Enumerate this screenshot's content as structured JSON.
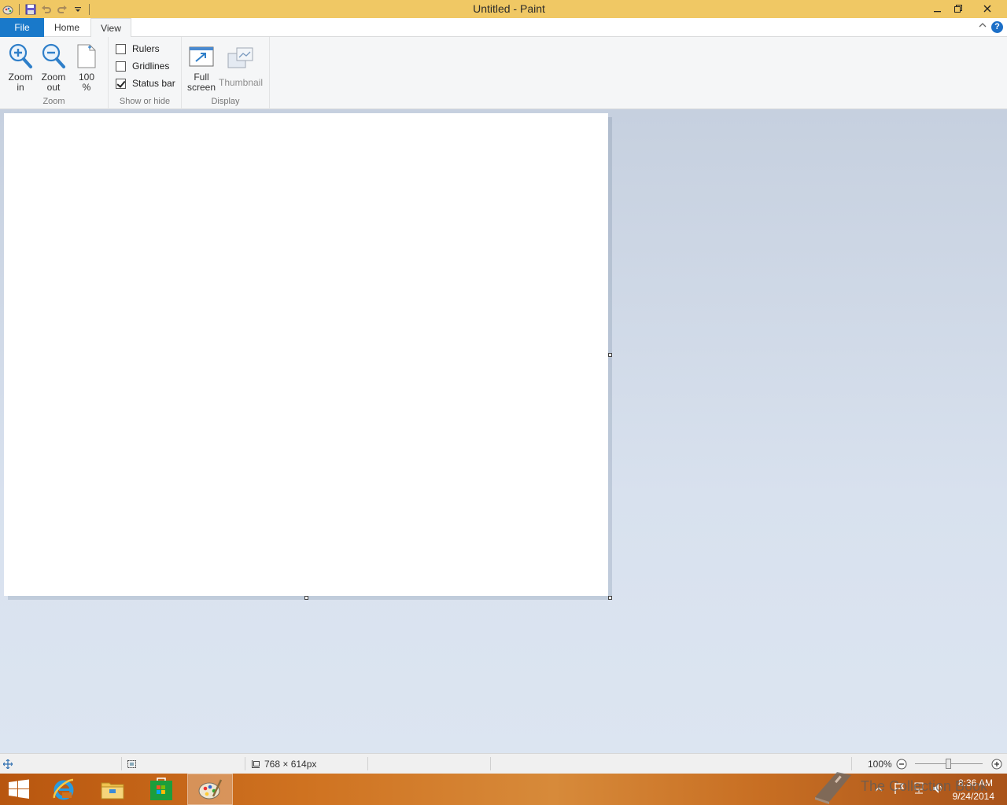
{
  "window": {
    "title": "Untitled - Paint",
    "minimize_icon": "minimize-icon",
    "restore_icon": "restore-icon",
    "close_icon": "close-icon"
  },
  "qat": {
    "items": [
      "paint-app-icon",
      "save-icon",
      "undo-icon",
      "redo-icon",
      "customize-qat-icon"
    ]
  },
  "tabs": {
    "file": "File",
    "home": "Home",
    "view": "View",
    "active": "View"
  },
  "ribbon": {
    "zoom_group": {
      "label": "Zoom",
      "zoom_in_line1": "Zoom",
      "zoom_in_line2": "in",
      "zoom_out_line1": "Zoom",
      "zoom_out_line2": "out",
      "hundred_line1": "100",
      "hundred_line2": "%"
    },
    "show_hide_group": {
      "label": "Show or hide",
      "rulers": "Rulers",
      "rulers_checked": false,
      "gridlines": "Gridlines",
      "gridlines_checked": false,
      "status_bar": "Status bar",
      "status_bar_checked": true
    },
    "display_group": {
      "label": "Display",
      "full_screen_line1": "Full",
      "full_screen_line2": "screen",
      "thumbnail": "Thumbnail"
    }
  },
  "statusbar": {
    "image_size": "768 × 614px",
    "zoom_level": "100%",
    "zoom_slider_value_percent": 100
  },
  "taskbar": {
    "items": [
      "start-button",
      "internet-explorer",
      "file-explorer",
      "store",
      "paint"
    ],
    "active": "paint",
    "time": "8:36 AM",
    "date": "9/24/2014"
  },
  "watermark": {
    "text": "The Collection Book"
  },
  "colors": {
    "title_bar": "#f0c864",
    "file_tab": "#1979ca",
    "workspace": "#cfd8e6",
    "taskbar": "#cf7220"
  }
}
